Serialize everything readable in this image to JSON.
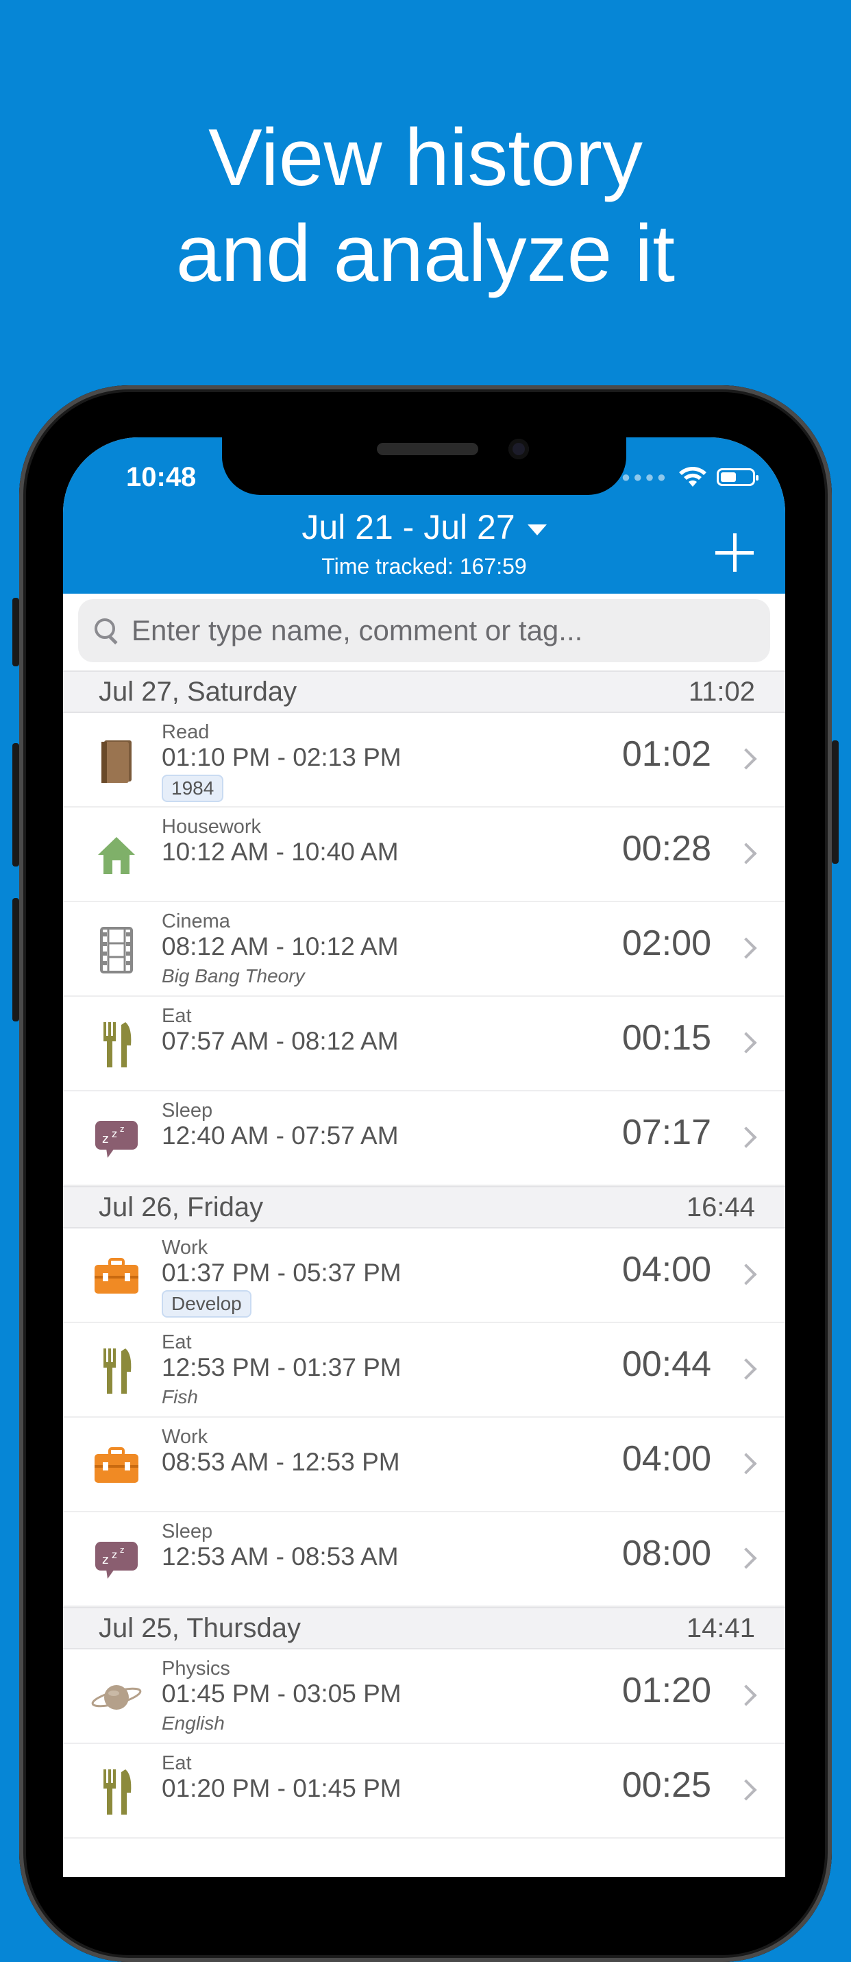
{
  "headline": {
    "line1": "View history",
    "line2": "and analyze it"
  },
  "status_bar": {
    "time": "10:48"
  },
  "header": {
    "date_range": "Jul 21 - Jul 27",
    "time_tracked": "Time tracked: 167:59"
  },
  "search": {
    "placeholder": "Enter type name, comment or tag..."
  },
  "icons": {
    "read": "book-icon",
    "housework": "house-icon",
    "cinema": "film-icon",
    "eat": "fork-knife-icon",
    "sleep": "sleep-bubble-icon",
    "work": "briefcase-icon",
    "physics": "planet-icon"
  },
  "colors": {
    "accent": "#0686d6",
    "tag_bg": "#e6eef9"
  },
  "days": [
    {
      "label": "Jul 27, Saturday",
      "total": "11:02",
      "entries": [
        {
          "type": "Read",
          "range": "01:10 PM - 02:13 PM",
          "tag": "1984",
          "comment": "",
          "duration": "01:02",
          "icon": "read"
        },
        {
          "type": "Housework",
          "range": "10:12 AM - 10:40 AM",
          "tag": "",
          "comment": "",
          "duration": "00:28",
          "icon": "housework"
        },
        {
          "type": "Cinema",
          "range": "08:12 AM - 10:12 AM",
          "tag": "",
          "comment": "Big Bang Theory",
          "duration": "02:00",
          "icon": "cinema"
        },
        {
          "type": "Eat",
          "range": "07:57 AM - 08:12 AM",
          "tag": "",
          "comment": "",
          "duration": "00:15",
          "icon": "eat"
        },
        {
          "type": "Sleep",
          "range": "12:40 AM - 07:57 AM",
          "tag": "",
          "comment": "",
          "duration": "07:17",
          "icon": "sleep"
        }
      ]
    },
    {
      "label": "Jul 26, Friday",
      "total": "16:44",
      "entries": [
        {
          "type": "Work",
          "range": "01:37 PM - 05:37 PM",
          "tag": "Develop",
          "comment": "",
          "duration": "04:00",
          "icon": "work"
        },
        {
          "type": "Eat",
          "range": "12:53 PM - 01:37 PM",
          "tag": "",
          "comment": "Fish",
          "duration": "00:44",
          "icon": "eat"
        },
        {
          "type": "Work",
          "range": "08:53 AM - 12:53 PM",
          "tag": "",
          "comment": "",
          "duration": "04:00",
          "icon": "work"
        },
        {
          "type": "Sleep",
          "range": "12:53 AM - 08:53 AM",
          "tag": "",
          "comment": "",
          "duration": "08:00",
          "icon": "sleep"
        }
      ]
    },
    {
      "label": "Jul 25, Thursday",
      "total": "14:41",
      "entries": [
        {
          "type": "Physics",
          "range": "01:45 PM - 03:05 PM",
          "tag": "",
          "comment": "English",
          "duration": "01:20",
          "icon": "physics"
        },
        {
          "type": "Eat",
          "range": "01:20 PM - 01:45 PM",
          "tag": "",
          "comment": "",
          "duration": "00:25",
          "icon": "eat"
        }
      ]
    }
  ]
}
